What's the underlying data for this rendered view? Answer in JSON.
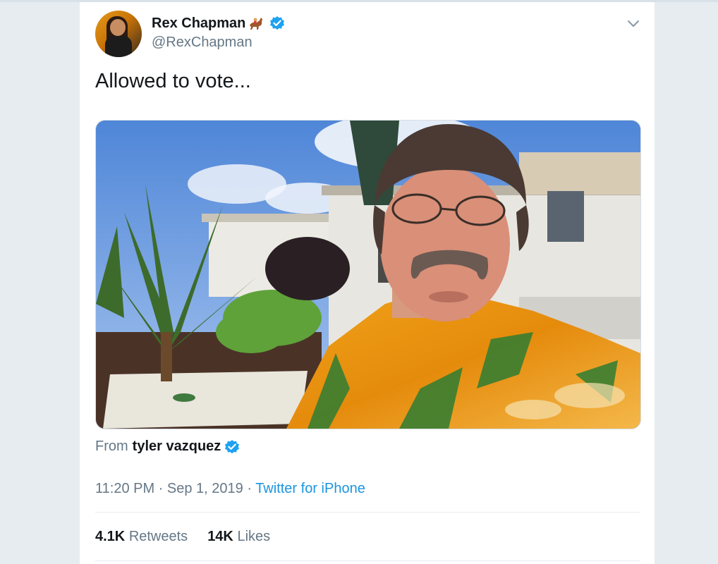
{
  "tweet": {
    "author_name": "Rex Chapman",
    "author_handle": "@RexChapman",
    "text": "Allowed to vote...",
    "from_label": "From",
    "from_name": "tyler vazquez",
    "time": "11:20 PM · Sep 1, 2019 · ",
    "source": "Twitter for iPhone",
    "retweets_count": "4.1K",
    "retweets_label": "Retweets",
    "likes_count": "14K",
    "likes_label": "Likes"
  },
  "icons": {
    "verified": "verified-badge-icon",
    "horse": "horse-racing-icon",
    "menu": "chevron-down-icon"
  },
  "colors": {
    "accent": "#1da1f2",
    "link": "#1b95e0",
    "text_primary": "#14171a",
    "text_secondary": "#657786",
    "background": "#e6ecf0"
  }
}
